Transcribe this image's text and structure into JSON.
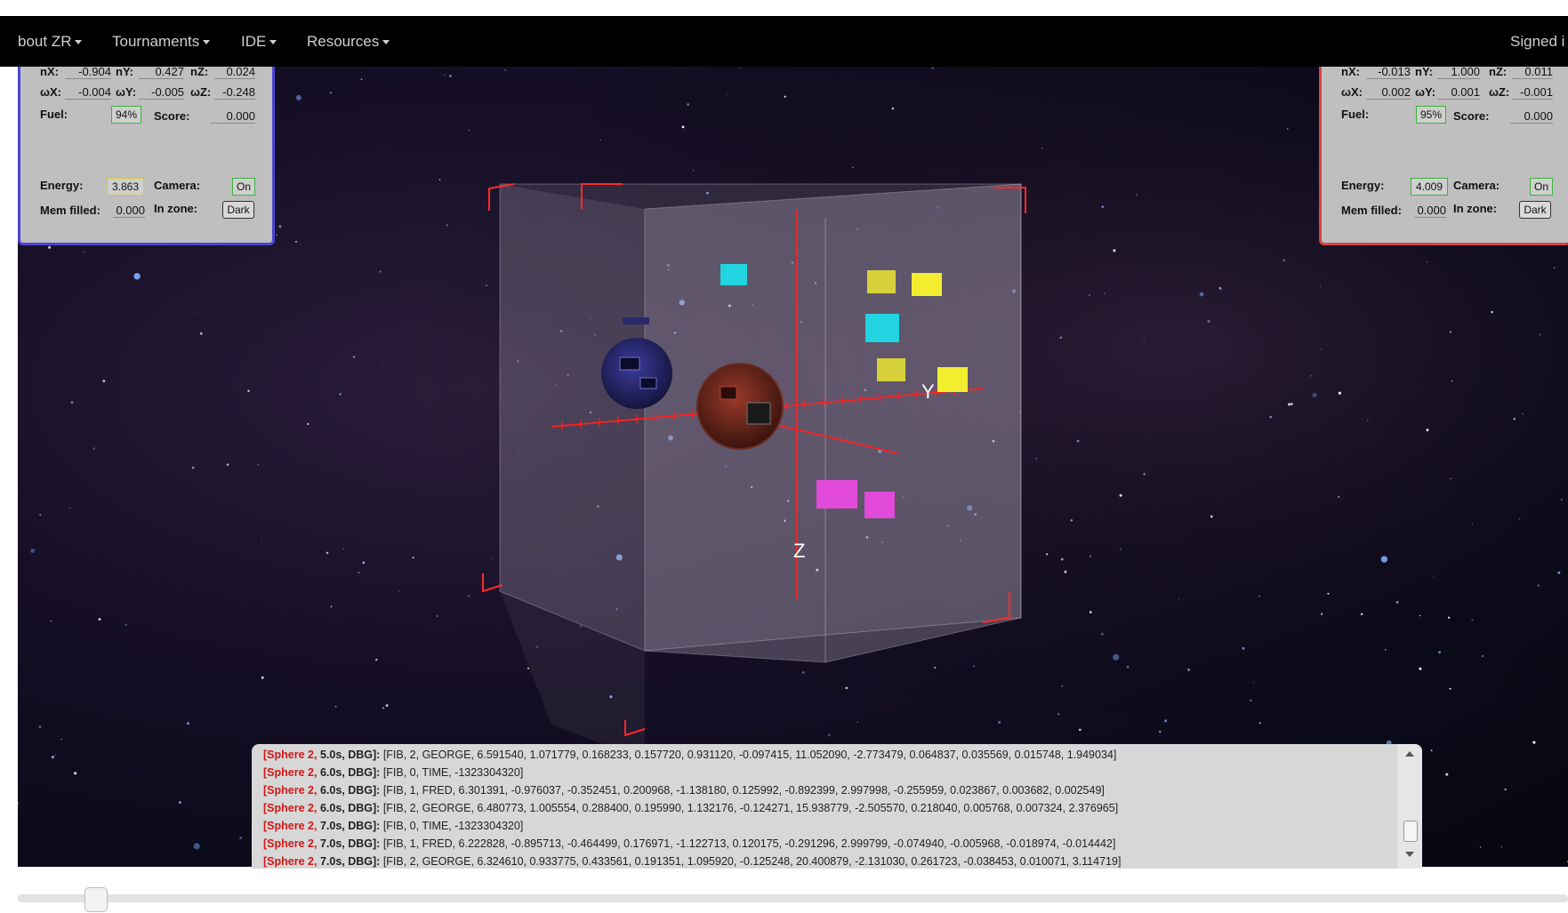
{
  "nav": {
    "items": [
      {
        "label": "bout ZR"
      },
      {
        "label": "Tournaments"
      },
      {
        "label": "IDE"
      },
      {
        "label": "Resources"
      }
    ],
    "signed": "Signed i"
  },
  "left_panel": {
    "labels": {
      "nx": "nX:",
      "ny": "nY:",
      "nz": "nZ:",
      "wx": "ωX:",
      "wy": "ωY:",
      "wz": "ωZ:",
      "fuel": "Fuel:",
      "score": "Score:",
      "energy": "Energy:",
      "camera": "Camera:",
      "mem": "Mem filled:",
      "zone": "In zone:"
    },
    "values": {
      "nx": "-0.904",
      "ny": "0.427",
      "nz": "0.024",
      "wx": "-0.004",
      "wy": "-0.005",
      "wz": "-0.248",
      "fuel": "94%",
      "score": "0.000",
      "energy": "3.863",
      "camera": "On",
      "mem": "0.000",
      "zone": "Dark"
    },
    "energy_status": 0.6
  },
  "right_panel": {
    "labels": {
      "nx": "nX:",
      "ny": "nY:",
      "nz": "nZ:",
      "wx": "ωX:",
      "wy": "ωY:",
      "wz": "ωZ:",
      "fuel": "Fuel:",
      "score": "Score:",
      "energy": "Energy:",
      "camera": "Camera:",
      "mem": "Mem filled:",
      "zone": "In zone:"
    },
    "values": {
      "nx": "-0.013",
      "ny": "1.000",
      "nz": "0.011",
      "wx": "0.002",
      "wy": "0.001",
      "wz": "-0.001",
      "fuel": "95%",
      "score": "0.000",
      "energy": "4.009",
      "camera": "On",
      "mem": "0.000",
      "zone": "Dark"
    }
  },
  "scene": {
    "axis_labels": {
      "y": "Y",
      "z": "Z"
    },
    "colors": {
      "cyan": "#22d3e0",
      "yellow": "#e9e43a",
      "magenta": "#e24ad9",
      "axis": "#ff2020"
    }
  },
  "console": {
    "lines": [
      {
        "src": "Sphere 2",
        "time": "5.0s, DBG",
        "text": "[FIB, 2, GEORGE, 6.591540, 1.071779, 0.168233, 0.157720, 0.931120, -0.097415, 11.052090, -2.773479, 0.064837, 0.035569, 0.015748, 1.949034]"
      },
      {
        "src": "Sphere 2",
        "time": "6.0s, DBG",
        "text": "[FIB, 0, TIME, -1323304320]"
      },
      {
        "src": "Sphere 2",
        "time": "6.0s, DBG",
        "text": "[FIB, 1, FRED, 6.301391, -0.976037, -0.352451, 0.200968, -1.138180, 0.125992, -0.892399, 2.997998, -0.255959, 0.023867, 0.003682, 0.002549]"
      },
      {
        "src": "Sphere 2",
        "time": "6.0s, DBG",
        "text": "[FIB, 2, GEORGE, 6.480773, 1.005554, 0.288400, 0.195990, 1.132176, -0.124271, 15.938779, -2.505570, 0.218040, 0.005768, 0.007324, 2.376965]"
      },
      {
        "src": "Sphere 2",
        "time": "7.0s, DBG",
        "text": "[FIB, 0, TIME, -1323304320]"
      },
      {
        "src": "Sphere 2",
        "time": "7.0s, DBG",
        "text": "[FIB, 1, FRED, 6.222828, -0.895713, -0.464499, 0.176971, -1.122713, 0.120175, -0.291296, 2.999799, -0.074940, -0.005968, -0.018974, -0.014442]"
      },
      {
        "src": "Sphere 2",
        "time": "7.0s, DBG",
        "text": "[FIB, 2, GEORGE, 6.324610, 0.933775, 0.433561, 0.191351, 1.095920, -0.125248, 20.400879, -2.131030, 0.261723, -0.038453, 0.010071, 3.114719]"
      }
    ]
  },
  "playback": {
    "position": 0.05
  }
}
